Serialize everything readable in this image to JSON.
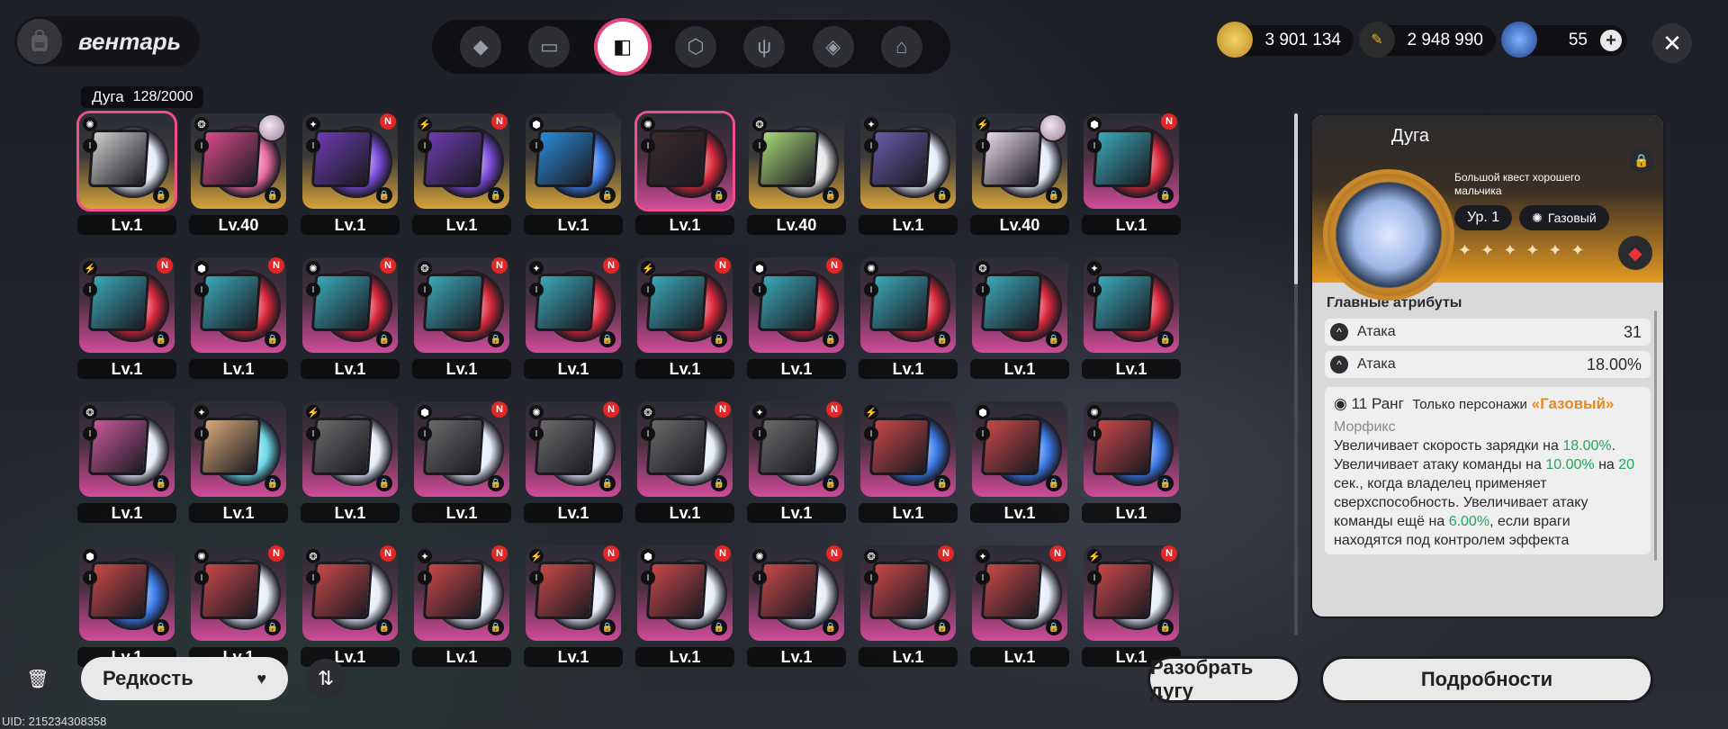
{
  "header": {
    "title": "вентарь"
  },
  "nav": {
    "icons": [
      "agent-icon",
      "console-icon",
      "disc-icon",
      "box-icon",
      "food-icon",
      "cube-icon",
      "home-icon"
    ],
    "active": 2
  },
  "currencies": [
    {
      "name": "coin-icon",
      "value": "3 901 134",
      "color": "#e3b43a"
    },
    {
      "name": "ticket-icon",
      "value": "2 948 990",
      "color": "#3a3a3a"
    },
    {
      "name": "gem-icon",
      "value": "55",
      "color": "#2f6fd8"
    }
  ],
  "inventory": {
    "label": "Дуга",
    "count": "128/2000"
  },
  "grid": {
    "rows": [
      [
        "Lv.1",
        "Lv.40",
        "Lv.1",
        "Lv.1",
        "Lv.1",
        "Lv.1",
        "Lv.40",
        "Lv.1",
        "Lv.40",
        "Lv.1"
      ],
      [
        "Lv.1",
        "Lv.1",
        "Lv.1",
        "Lv.1",
        "Lv.1",
        "Lv.1",
        "Lv.1",
        "Lv.1",
        "Lv.1",
        "Lv.1"
      ],
      [
        "Lv.1",
        "Lv.1",
        "Lv.1",
        "Lv.1",
        "Lv.1",
        "Lv.1",
        "Lv.1",
        "Lv.1",
        "Lv.1",
        "Lv.1"
      ],
      [
        "Lv.1",
        "Lv.1",
        "Lv.1",
        "Lv.1",
        "Lv.1",
        "Lv.1",
        "Lv.1",
        "Lv.1",
        "Lv.1",
        "Lv.1"
      ]
    ],
    "new_badge": "N",
    "rank_mark": "I"
  },
  "filter": {
    "label": "Редкость"
  },
  "uid": "UID: 215234308358",
  "buttons": {
    "dismantle": "Разобрать дугу",
    "details": "Подробности"
  },
  "detail": {
    "name": "Дуга",
    "subtitle": "Большой квест хорошего мальчика",
    "level": "Ур. 1",
    "element": "Газовый",
    "main_attrs_title": "Главные атрибуты",
    "attrs": [
      {
        "label": "Атака",
        "value": "31"
      },
      {
        "label": "Атака",
        "value": "18.00%"
      }
    ],
    "skill_rank": "11 Ранг",
    "skill_req_prefix": "Только персонажи",
    "skill_req": "«Газовый»",
    "skill_name": "Морфикс",
    "skill_text_1": "Увеличивает скорость зарядки на ",
    "skill_val_1": "18.00%",
    "skill_text_2": ". Увеличивает атаку команды на ",
    "skill_val_2": "10.00%",
    "skill_text_3": " на ",
    "skill_val_3": "20",
    "skill_text_4": " сек., когда владелец применяет сверхспособность. Увеличивает атаку команды ещё на ",
    "skill_val_4": "6.00%",
    "skill_text_5": ", если враги находятся под контролем эффекта"
  }
}
